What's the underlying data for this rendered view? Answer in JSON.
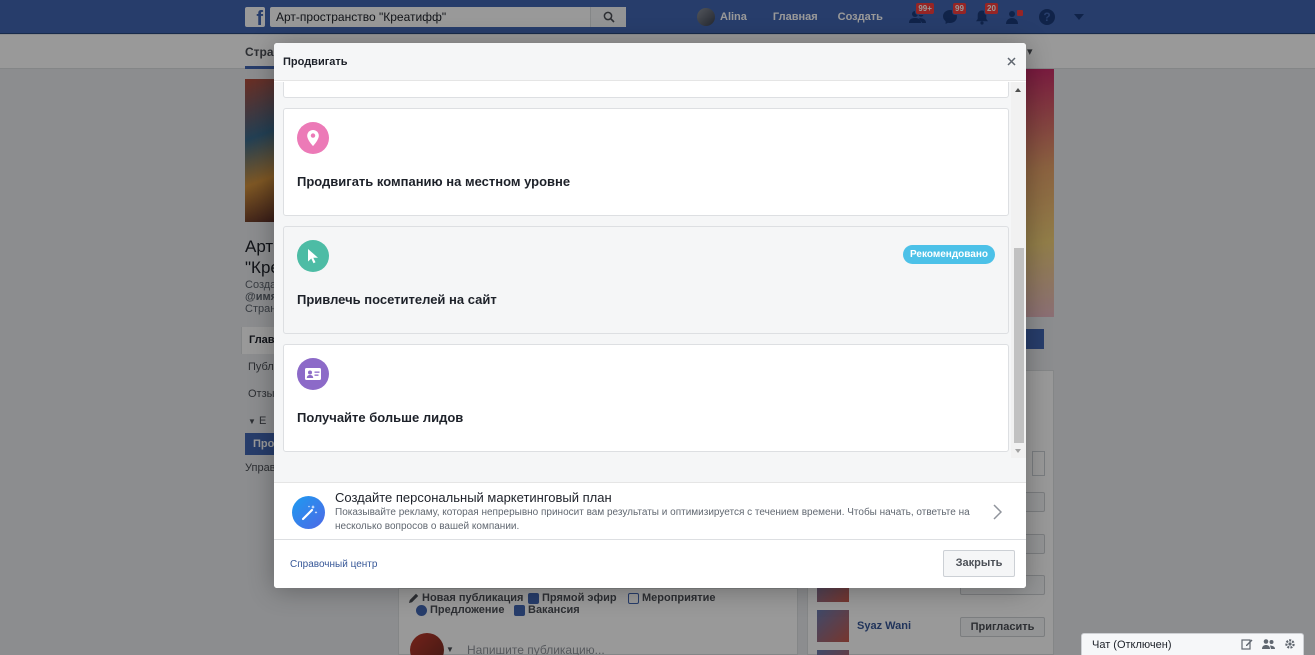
{
  "topbar": {
    "search_value": "Арт-пространство \"Креатифф\"",
    "user_name": "Alina",
    "nav_home": "Главная",
    "nav_create": "Создать",
    "badge_friends": "99+",
    "badge_messages": "99",
    "badge_notifications": "20",
    "brand_color": "#4267b2"
  },
  "subnav": {
    "tab_label": "Стра"
  },
  "background_page": {
    "page_name": "Арт-\n\"Кре",
    "meta_line1": "Созда",
    "meta_line2": "@имя",
    "meta_line3": "Стран",
    "left_nav": [
      "Глав",
      "Публ",
      "Отзы",
      "Е"
    ],
    "promote_button": "Прод",
    "manage_label": "Управ"
  },
  "composer": {
    "new_post": "Новая публикация",
    "live": "Прямой эфир",
    "event": "Мероприятие",
    "offer": "Предложение",
    "job": "Вакансия",
    "placeholder": "Напишите публикацию..."
  },
  "invites": {
    "person_name": "Syaz Wani",
    "invite_label": "Пригласить"
  },
  "chat": {
    "label": "Чат (Отключен)"
  },
  "modal": {
    "title": "Продвигать",
    "cards": [
      {
        "title": "Продвигать компанию на местном уровне",
        "icon": "location-pin-icon",
        "icon_color": "#ec7ab7",
        "recommended": ""
      },
      {
        "title": "Привлечь посетителей на сайт",
        "icon": "cursor-icon",
        "icon_color": "#4dbca5",
        "recommended": "Рекомендовано"
      },
      {
        "title": "Получайте больше лидов",
        "icon": "contact-card-icon",
        "icon_color": "#8c6ac8",
        "recommended": ""
      }
    ],
    "plan": {
      "title": "Создайте персональный маркетинговый план",
      "description": "Показывайте рекламу, которая непрерывно приносит вам результаты и оптимизируется с течением времени. Чтобы начать, ответьте на несколько вопросов о вашей компании."
    },
    "footer": {
      "help_link": "Справочный центр",
      "close_button": "Закрыть"
    },
    "badge_color": "#4cc1e8"
  }
}
